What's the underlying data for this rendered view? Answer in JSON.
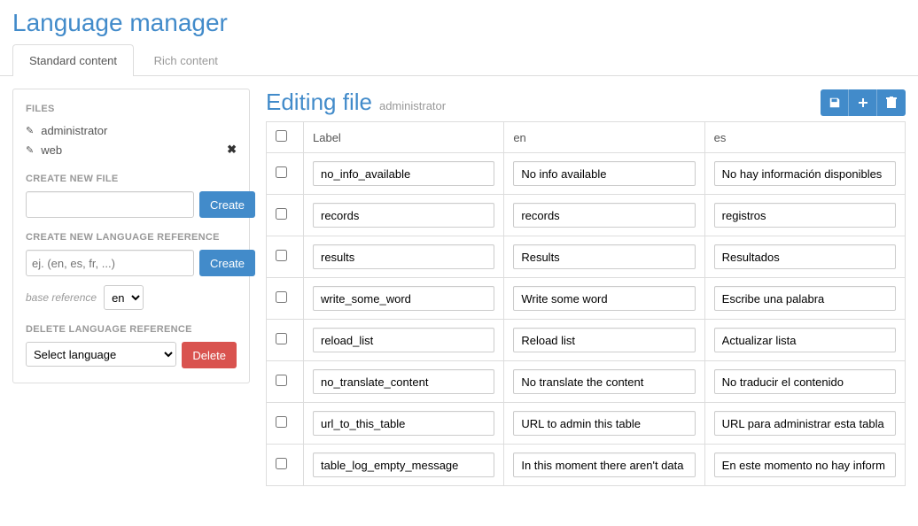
{
  "page_title": "Language manager",
  "tabs": {
    "standard": "Standard content",
    "rich": "Rich content"
  },
  "sidebar": {
    "files_title": "FILES",
    "files": [
      "administrator",
      "web"
    ],
    "create_file_title": "CREATE NEW FILE",
    "create_file_button": "Create",
    "create_lang_title": "CREATE NEW LANGUAGE REFERENCE",
    "create_lang_placeholder": "ej. (en, es, fr, ...)",
    "create_lang_button": "Create",
    "base_reference_label": "base reference",
    "base_reference_value": "en",
    "delete_lang_title": "DELETE LANGUAGE REFERENCE",
    "delete_lang_select": "Select language",
    "delete_lang_button": "Delete"
  },
  "main": {
    "editing_title": "Editing file",
    "editing_subtitle": "administrator",
    "columns": {
      "label": "Label",
      "en": "en",
      "es": "es"
    },
    "rows": [
      {
        "label": "no_info_available",
        "en": "No info available",
        "es": "No hay información disponibles"
      },
      {
        "label": "records",
        "en": "records",
        "es": "registros"
      },
      {
        "label": "results",
        "en": "Results",
        "es": "Resultados"
      },
      {
        "label": "write_some_word",
        "en": "Write some word",
        "es": "Escribe una palabra"
      },
      {
        "label": "reload_list",
        "en": "Reload list",
        "es": "Actualizar lista"
      },
      {
        "label": "no_translate_content",
        "en": "No translate the content",
        "es": "No traducir el contenido"
      },
      {
        "label": "url_to_this_table",
        "en": "URL to admin this table",
        "es": "URL para administrar esta tabla"
      },
      {
        "label": "table_log_empty_message",
        "en": "In this moment there aren't data",
        "es": "En este momento no hay inform"
      }
    ]
  }
}
